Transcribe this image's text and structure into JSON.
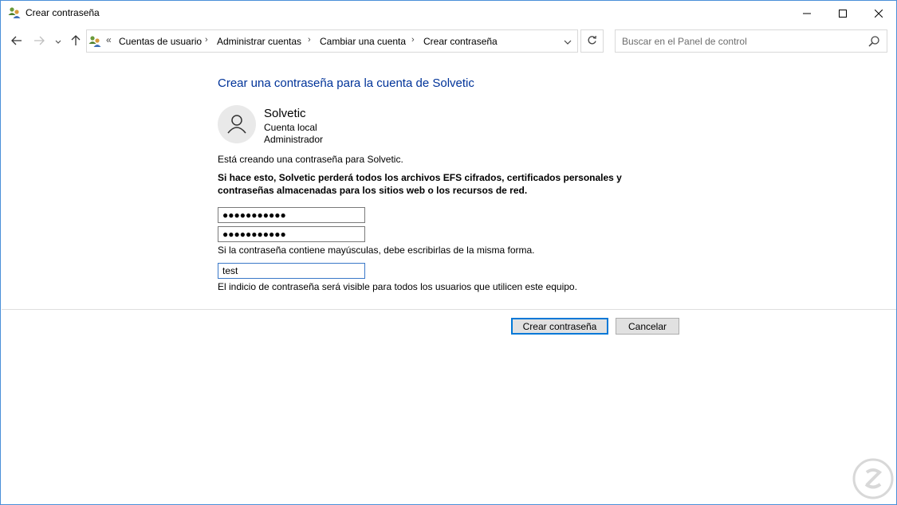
{
  "window": {
    "title": "Crear contraseña",
    "title_icon": "user-accounts-icon"
  },
  "controls": {
    "minimize": "minimize-icon",
    "maximize": "maximize-icon",
    "close": "close-icon"
  },
  "address": {
    "overflow": "«",
    "crumbs": [
      "Cuentas de usuario",
      "Administrar cuentas",
      "Cambiar una cuenta",
      "Crear contraseña"
    ],
    "separator": "›"
  },
  "search": {
    "placeholder": "Buscar en el Panel de control"
  },
  "content": {
    "heading": "Crear una contraseña para la cuenta de Solvetic",
    "account": {
      "name": "Solvetic",
      "type": "Cuenta local",
      "role": "Administrador"
    },
    "info": "Está creando una contraseña para Solvetic.",
    "warning": "Si hace esto, Solvetic perderá todos los archivos EFS cifrados, certificados personales y contraseñas almacenadas para los sitios web o los recursos de red.",
    "new_password": "●●●●●●●●●●●",
    "confirm_password": "●●●●●●●●●●●",
    "case_note": "Si la contraseña contiene mayúsculas, debe escribirlas de la misma forma.",
    "hint_value": "test",
    "hint_note": "El indicio de contraseña será visible para todos los usuarios que utilicen este equipo."
  },
  "buttons": {
    "create": "Crear contraseña",
    "cancel": "Cancelar"
  },
  "colors": {
    "heading": "#003399",
    "accent": "#0078d7",
    "window_border": "#4a90d9"
  }
}
